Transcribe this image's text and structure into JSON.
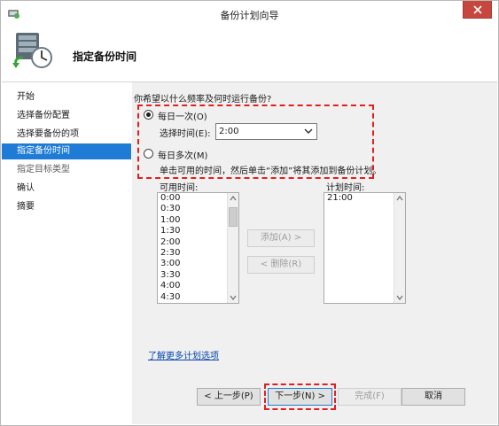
{
  "window": {
    "title": "备份计划向导"
  },
  "header": {
    "title": "指定备份时间",
    "icon": "backup-schedule-icon"
  },
  "nav": {
    "items": [
      {
        "label": "开始",
        "state": "done"
      },
      {
        "label": "选择备份配置",
        "state": "done"
      },
      {
        "label": "选择要备份的项",
        "state": "done"
      },
      {
        "label": "指定备份时间",
        "state": "active"
      },
      {
        "label": "指定目标类型",
        "state": "future"
      },
      {
        "label": "确认",
        "state": "done"
      },
      {
        "label": "摘要",
        "state": "done"
      }
    ]
  },
  "main": {
    "question": "你希望以什么频率及何时运行备份?",
    "once_daily": {
      "label": "每日一次(O)",
      "checked": true
    },
    "select_time_label": "选择时间(E):",
    "select_time_value": "2:00",
    "multiple_daily": {
      "label": "每日多次(M)",
      "checked": false
    },
    "multiple_hint": "单击可用的时间，然后单击“添加”将其添加到备份计划。",
    "available_label": "可用时间:",
    "available_times": [
      "0:00",
      "0:30",
      "1:00",
      "1:30",
      "2:00",
      "2:30",
      "3:00",
      "3:30",
      "4:00",
      "4:30"
    ],
    "scheduled_label": "计划时间:",
    "scheduled_times": [
      "21:00"
    ],
    "add_button": "添加(A) >",
    "remove_button": "< 删除(R)",
    "learn_more_link": "了解更多计划选项"
  },
  "footer": {
    "prev_button": "< 上一步(P)",
    "next_button": "下一步(N) >",
    "finish_button": "完成(F)",
    "cancel_button": "取消"
  },
  "colors": {
    "accent": "#1e7cd6",
    "highlight_dash": "#e02020",
    "close_button": "#c7473f",
    "content_bg": "#f0f0f0"
  }
}
